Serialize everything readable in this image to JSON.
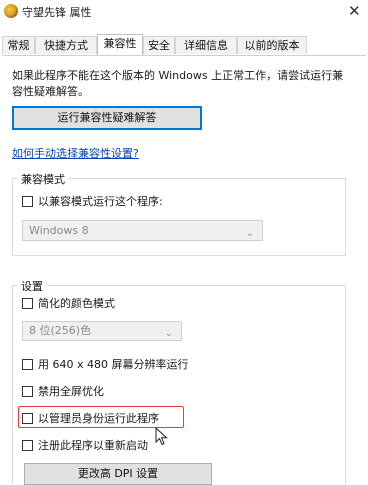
{
  "window": {
    "title": "守望先锋 属性",
    "close_glyph": "✕",
    "app_icon": "overwatch-icon"
  },
  "tabs": [
    {
      "label": "常规"
    },
    {
      "label": "快捷方式"
    },
    {
      "label": "兼容性"
    },
    {
      "label": "安全"
    },
    {
      "label": "详细信息"
    },
    {
      "label": "以前的版本"
    }
  ],
  "compat": {
    "intro": "如果此程序不能在这个版本的 Windows 上正常工作，请尝试运行兼容性疑难解答。",
    "troubleshoot_button": "运行兼容性疑难解答",
    "manual_link": "如何手动选择兼容性设置?",
    "mode_group": {
      "title": "兼容模式",
      "checkbox_label": "以兼容模式运行这个程序:",
      "os_select": "Windows 8"
    },
    "settings_group": {
      "title": "设置",
      "reduced_color": "简化的颜色模式",
      "color_select": "8 位(256)色",
      "res_640": "用 640 x 480 屏幕分辨率运行",
      "disable_fullscreen": "禁用全屏优化",
      "run_as_admin": "以管理员身份运行此程序",
      "register_restart": "注册此程序以重新启动",
      "dpi_button": "更改高 DPI 设置"
    }
  },
  "colors": {
    "highlight": "#e83a3a",
    "link": "#0645ad",
    "focus": "#0078d7"
  }
}
